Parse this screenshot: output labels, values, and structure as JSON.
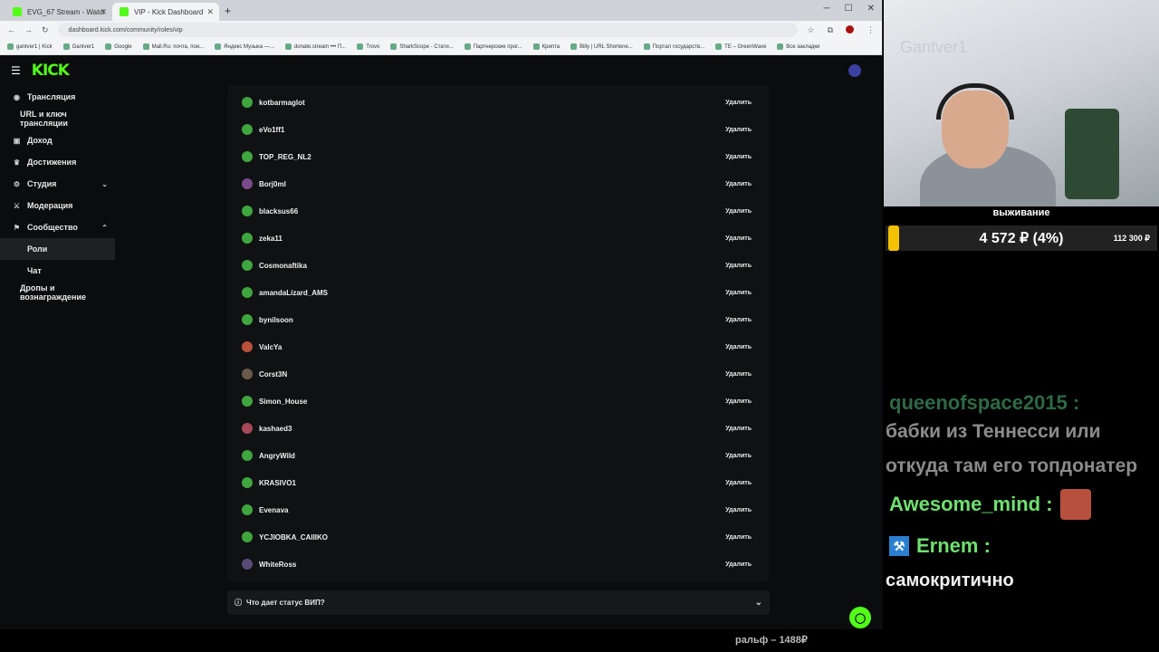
{
  "browser": {
    "tabs": [
      {
        "label": "EVG_67 Stream - Watch Live on",
        "active": false
      },
      {
        "label": "VIP - Kick Dashboard",
        "active": true
      }
    ],
    "url": "dashboard.kick.com/community/roles/vip",
    "bookmarks": [
      "gantver1 | Kick",
      "Gantver1",
      "Google",
      "Mail.Ru: почта, пои...",
      "Яндекс Музыка —...",
      "donate.stream ••• П...",
      "Trovo",
      "SharkScope - Стати...",
      "Партнерские прог...",
      "Крипта",
      "Billy | URL Shortene...",
      "Портал государств...",
      "TE – GreenWave",
      "Все закладки"
    ]
  },
  "app": {
    "logo": "KICK"
  },
  "sidebar": {
    "items": [
      {
        "label": "Трансляция",
        "icon": "broadcast-icon"
      },
      {
        "label": "URL и ключ трансляции",
        "icon": ""
      },
      {
        "label": "Доход",
        "icon": "wallet-icon"
      },
      {
        "label": "Достижения",
        "icon": "trophy-icon"
      },
      {
        "label": "Студия",
        "icon": "studio-icon"
      },
      {
        "label": "Модерация",
        "icon": "sword-icon"
      },
      {
        "label": "Сообщество",
        "icon": "community-icon"
      },
      {
        "label": "Роли",
        "icon": ""
      },
      {
        "label": "Чат",
        "icon": ""
      },
      {
        "label": "Дропы и вознаграждение",
        "icon": ""
      }
    ]
  },
  "vip_list": {
    "remove_label": "Удалить",
    "users": [
      "kotbarmaglot",
      "eVo1ff1",
      "TOP_REG_NL2",
      "Borj0ml",
      "blacksus66",
      "zeka11",
      "Cosmonaftika",
      "amandaLizard_AMS",
      "bynilsoon",
      "ValcYa",
      "Corst3N",
      "Simon_House",
      "kashaed3",
      "AngryWild",
      "KRASIVO1",
      "Evenava",
      "YCJIOBKA_CAIIIKO",
      "WhiteRoss"
    ]
  },
  "faq": {
    "label": "Что дает статус ВИП?"
  },
  "stream": {
    "webcam_watermark": "Gantver1",
    "goal_title": "выживание",
    "goal_current": "4 572 ₽ (4%)",
    "goal_target": "112 300 ₽",
    "goal_progress": 0.04,
    "goal_color": "#f2c200",
    "chat": {
      "user1": "queenofspace2015 :",
      "text1": "бабки из Теннесси или откуда там его топдонатер",
      "user2": "Awesome_mind :",
      "user3": "Ernem :",
      "text3": "самокритично"
    },
    "ticker": "ральф – 1488₽"
  },
  "colors": {
    "accent": "#53fc18",
    "background": "#0b0c0d",
    "panel": "#101112"
  }
}
